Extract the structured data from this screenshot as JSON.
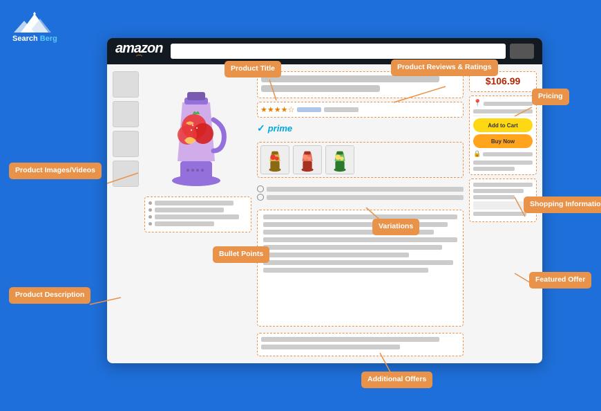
{
  "logo": {
    "company": "Search Berg"
  },
  "amazon": {
    "logo": "amazon",
    "price": "$106.99",
    "prime_text": "prime",
    "add_to_cart": "Add to Cart",
    "buy_now": "Buy Now"
  },
  "labels": {
    "product_title": "Product Title",
    "product_reviews": "Product Reviews\n& Ratings",
    "product_images": "Product\nImages/Videos",
    "pricing": "Pricing",
    "shopping_info": "Shopping\nInformation",
    "featured_offer": "Featured\nOffer",
    "bullet_points": "Bullet Points",
    "variations": "Variations",
    "product_description": "Product\nDescription",
    "additional_offers": "Additional Offers"
  },
  "colors": {
    "background": "#1565C0",
    "label_bg": "#E8924A",
    "price_color": "#B12704",
    "amazon_header": "#131921"
  }
}
